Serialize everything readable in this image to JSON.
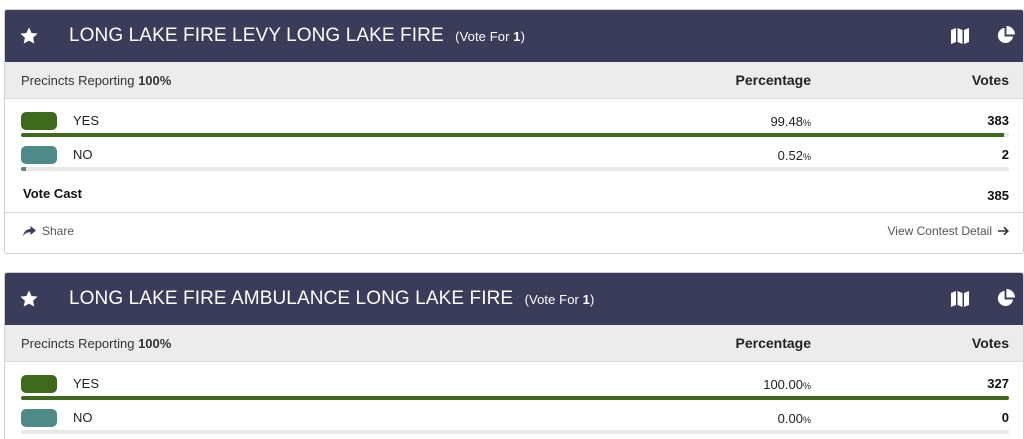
{
  "colors": {
    "header_bg": "#3a3c5a",
    "yes": "#3f6a1e",
    "no": "#4e8a86"
  },
  "contests": [
    {
      "title": "LONG LAKE FIRE LEVY LONG LAKE FIRE",
      "vote_for_prefix": "(Vote For ",
      "vote_for_num": "1",
      "vote_for_suffix": ")",
      "precincts_label": "Precincts Reporting ",
      "precincts_value": "100%",
      "percentage_header": "Percentage",
      "votes_header": "Votes",
      "choices": [
        {
          "label": "YES",
          "pct": "99.48",
          "pct_unit": "%",
          "votes": "383",
          "share": 0.9948,
          "color": "#3f6a1e"
        },
        {
          "label": "NO",
          "pct": "0.52",
          "pct_unit": "%",
          "votes": "2",
          "share": 0.0052,
          "color": "#4e8a86"
        }
      ],
      "total_label": "Vote Cast",
      "total_value": "385",
      "share_label": "Share",
      "detail_label": "View Contest Detail"
    },
    {
      "title": "LONG LAKE FIRE AMBULANCE LONG LAKE FIRE",
      "vote_for_prefix": "(Vote For ",
      "vote_for_num": "1",
      "vote_for_suffix": ")",
      "precincts_label": "Precincts Reporting ",
      "precincts_value": "100%",
      "percentage_header": "Percentage",
      "votes_header": "Votes",
      "choices": [
        {
          "label": "YES",
          "pct": "100.00",
          "pct_unit": "%",
          "votes": "327",
          "share": 1.0,
          "color": "#3f6a1e"
        },
        {
          "label": "NO",
          "pct": "0.00",
          "pct_unit": "%",
          "votes": "0",
          "share": 0.0,
          "color": "#4e8a86"
        }
      ]
    }
  ]
}
